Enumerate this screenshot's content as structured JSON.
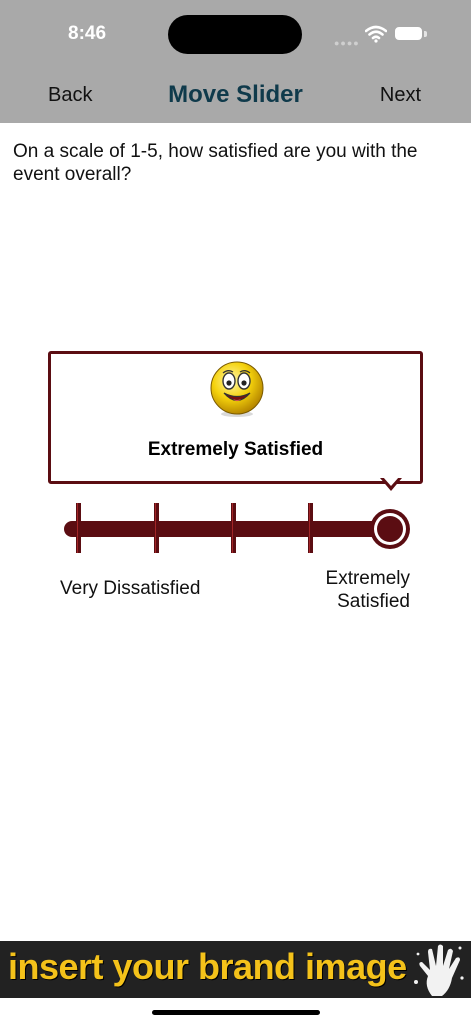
{
  "status_bar": {
    "time": "8:46"
  },
  "nav": {
    "back_label": "Back",
    "title": "Move Slider",
    "next_label": "Next"
  },
  "question": {
    "text": "On a scale of 1-5, how satisfied are you with the event overall?"
  },
  "slider": {
    "min": 1,
    "max": 5,
    "value": 5,
    "current_label": "Extremely Satisfied",
    "min_label": "Very Dissatisfied",
    "max_label": "Extremely Satisfied",
    "accent_color": "#5b0d12",
    "emoji_icon": "smiley-face-icon"
  },
  "brand": {
    "text": "insert your brand image",
    "text_color": "#f4c21a",
    "icon": "hand-print-icon"
  }
}
